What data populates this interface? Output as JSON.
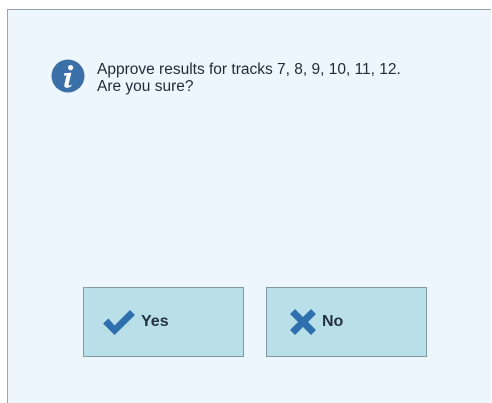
{
  "dialog": {
    "icon": "info-icon",
    "message_line1": "Approve results for tracks 7, 8, 9, 10, 11, 12.",
    "message_line2": "Are you sure?"
  },
  "buttons": {
    "yes": {
      "label": "Yes",
      "icon": "checkmark-icon",
      "color": "#2f6fae"
    },
    "no": {
      "label": "No",
      "icon": "cross-icon",
      "color": "#2f6fae"
    }
  },
  "colors": {
    "dialog_background": "#eef6fd",
    "button_background": "#b9dfe8",
    "icon_blue": "#3a6fa8"
  }
}
